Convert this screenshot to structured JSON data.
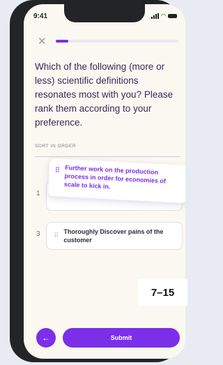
{
  "status_bar": {
    "time": "9:41"
  },
  "progress": {
    "fraction": 0.1
  },
  "question": "Which of the following (more or less) scientific definitions resonates most with you? Please rank them according to your preference.",
  "sort_label": "SORT IN ORDER",
  "ranks": {
    "first": "1",
    "third": "3"
  },
  "dragging_card": {
    "text": "Further work on the production process in order for economies of scale to kick in."
  },
  "cards": [
    {
      "text": "Thoroughly Discover pains of the customer"
    }
  ],
  "badge": "7–15",
  "footer": {
    "back_icon": "arrow-left-icon",
    "submit_label": "Submit"
  },
  "colors": {
    "accent": "#7b2fe8",
    "background": "#fbf8f1",
    "question_text": "#3c2a56"
  }
}
